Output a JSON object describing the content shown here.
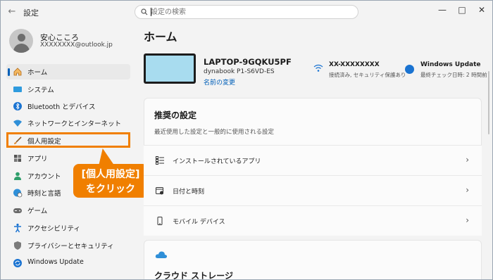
{
  "window": {
    "title": "設定"
  },
  "search": {
    "placeholder": "設定の検索"
  },
  "user": {
    "name": "安心こころ",
    "email": "XXXXXXXX@outlook.jp"
  },
  "sidebar": {
    "items": [
      {
        "label": "ホーム",
        "icon": "home-icon"
      },
      {
        "label": "システム",
        "icon": "system-icon"
      },
      {
        "label": "Bluetooth とデバイス",
        "icon": "bluetooth-icon"
      },
      {
        "label": "ネットワークとインターネット",
        "icon": "wifi-icon"
      },
      {
        "label": "個人用設定",
        "icon": "brush-icon"
      },
      {
        "label": "アプリ",
        "icon": "apps-icon"
      },
      {
        "label": "アカウント",
        "icon": "account-icon"
      },
      {
        "label": "時刻と言語",
        "icon": "globe-clock-icon"
      },
      {
        "label": "ゲーム",
        "icon": "gamepad-icon"
      },
      {
        "label": "アクセシビリティ",
        "icon": "accessibility-icon"
      },
      {
        "label": "プライバシーとセキュリティ",
        "icon": "shield-icon"
      },
      {
        "label": "Windows Update",
        "icon": "update-icon"
      }
    ]
  },
  "callout": {
    "line1": "[個人用設定]",
    "line2": "をクリック"
  },
  "main": {
    "title": "ホーム",
    "device": {
      "name": "LAPTOP-9GQKU5PF",
      "model": "dynabook P1-S6VD-ES",
      "rename": "名前の変更"
    },
    "network": {
      "name": "XX-XXXXXXXX",
      "status": "接続済み, セキュリティ保護あり"
    },
    "update": {
      "title": "Windows Update",
      "status": "最終チェック日時: 2 時間前"
    },
    "recommended": {
      "title": "推奨の設定",
      "subtitle": "最近使用した設定と一般的に使用される設定",
      "rows": [
        {
          "label": "インストールされているアプリ",
          "icon": "installed-apps-icon"
        },
        {
          "label": "日付と時刻",
          "icon": "calendar-clock-icon"
        },
        {
          "label": "モバイル デバイス",
          "icon": "phone-icon"
        }
      ]
    },
    "cloud": {
      "title": "クラウド ストレージ"
    }
  },
  "colors": {
    "accent": "#005fb8",
    "highlight": "#f07f00"
  }
}
